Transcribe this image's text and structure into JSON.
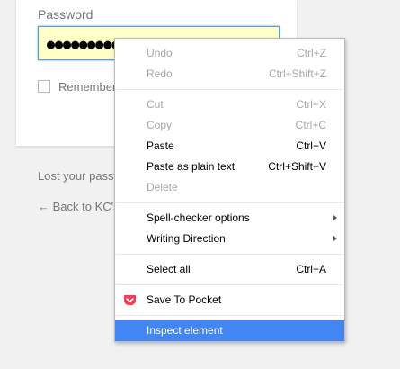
{
  "login": {
    "password_label": "Password",
    "password_value": "●●●●●●●●●●",
    "remember_label": "Remember Me",
    "lost_password": "Lost your password?",
    "back_link": "← Back to KC's"
  },
  "menu": {
    "undo": {
      "label": "Undo",
      "shortcut": "Ctrl+Z"
    },
    "redo": {
      "label": "Redo",
      "shortcut": "Ctrl+Shift+Z"
    },
    "cut": {
      "label": "Cut",
      "shortcut": "Ctrl+X"
    },
    "copy": {
      "label": "Copy",
      "shortcut": "Ctrl+C"
    },
    "paste": {
      "label": "Paste",
      "shortcut": "Ctrl+V"
    },
    "paste_plain": {
      "label": "Paste as plain text",
      "shortcut": "Ctrl+Shift+V"
    },
    "delete": {
      "label": "Delete"
    },
    "spell": {
      "label": "Spell-checker options"
    },
    "writing": {
      "label": "Writing Direction"
    },
    "select_all": {
      "label": "Select all",
      "shortcut": "Ctrl+A"
    },
    "pocket": {
      "label": "Save To Pocket",
      "icon": "pocket-icon",
      "icon_color": "#ee4056"
    },
    "inspect": {
      "label": "Inspect element"
    }
  },
  "colors": {
    "highlight": "#4285f4",
    "field_bg": "#ffffc8",
    "field_border": "#5b9dd9"
  }
}
